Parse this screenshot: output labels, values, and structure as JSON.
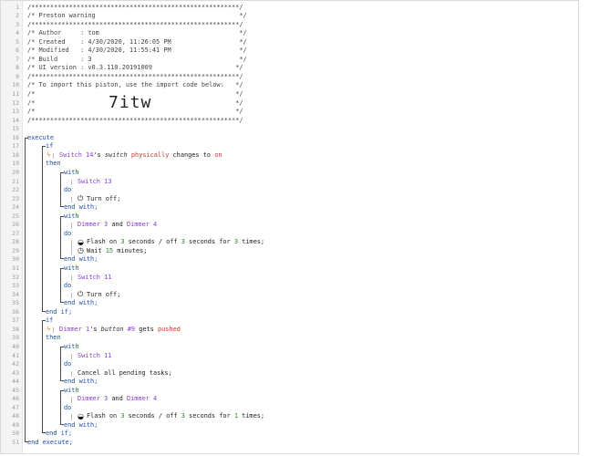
{
  "line_numbers": [
    "1",
    "2",
    "3",
    "4",
    "5",
    "6",
    "7",
    "8",
    "9",
    "10",
    "11",
    "12",
    "13",
    "14",
    "15",
    "16",
    "17",
    "18",
    "19",
    "20",
    "21",
    "22",
    "23",
    "24",
    "25",
    "26",
    "27",
    "28",
    "29",
    "30",
    "31",
    "32",
    "33",
    "34",
    "35",
    "36",
    "37",
    "38",
    "39",
    "40",
    "41",
    "42",
    "43",
    "44",
    "45",
    "46",
    "47",
    "48",
    "49",
    "50",
    "51"
  ],
  "header": {
    "border": "/*******************************************************/",
    "title": "/* Preston warning                                      */",
    "author": "/* Author     : tom                                     */",
    "created": "/* Created    : 4/30/2020, 11:26:05 PM                  */",
    "modified": "/* Modified   : 4/30/2020, 11:55:41 PM                  */",
    "build": "/* Build      : 3                                       */",
    "ui_version": "/* UI version : v0.3.110.20191009                      */",
    "import_hint": "/* To import this piston, use the import code below:   */",
    "blank": "/*                                                     */",
    "import_code": "7itw"
  },
  "code": {
    "execute": "execute",
    "end_execute": "end execute;",
    "if": "if",
    "then": "then",
    "end_if": "end if;",
    "with": "with",
    "do": "do",
    "end_with": "end with;",
    "and": "and",
    "trigger1": {
      "device": "Switch 14",
      "possessive": "'s",
      "attr": "switch",
      "cond": "physically",
      "changes": "changes to",
      "value": "on"
    },
    "trigger2": {
      "device": "Dimmer 1",
      "possessive": "'s",
      "attr": "button",
      "button_num": "#9",
      "gets": "gets",
      "value": "pushed"
    },
    "dev_switch13": "Switch 13",
    "dev_dimmer3": "Dimmer 3",
    "dev_dimmer4": "Dimmer 4",
    "dev_switch11": "Switch 11",
    "turn_off": "Turn off;",
    "flash1": {
      "pre": "Flash on ",
      "on": "3",
      "mid": " seconds / off ",
      "off": "3",
      "mid2": " seconds for ",
      "times": "3",
      "post": " times;"
    },
    "wait": {
      "pre": "Wait ",
      "val": "15",
      "post": " minutes;"
    },
    "cancel": "Cancel all pending tasks;",
    "flash2": {
      "pre": "Flash on ",
      "on": "3",
      "mid": " seconds / off ",
      "off": "3",
      "mid2": " seconds for ",
      "times": "1",
      "post": " times;"
    }
  },
  "icons": {
    "trigger_icon": "lightning-icon",
    "power_icon": "power-icon",
    "flash_icon": "flash-icon",
    "clock_icon": "clock-icon"
  }
}
